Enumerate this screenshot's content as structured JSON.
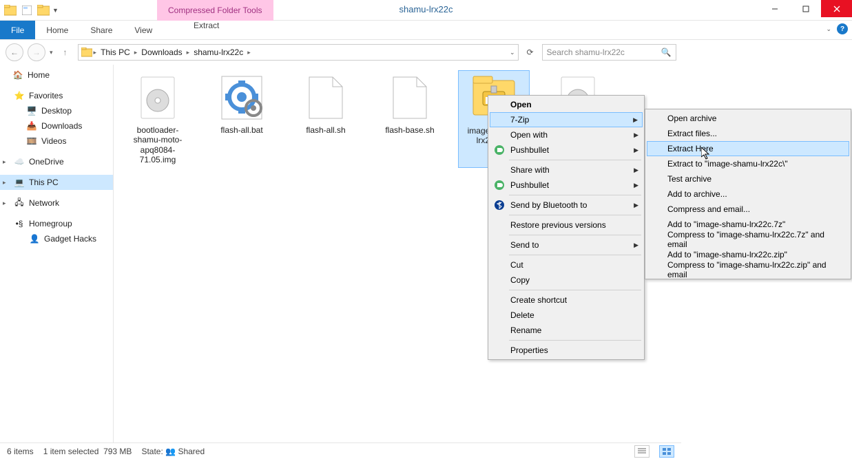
{
  "window": {
    "title": "shamu-lrx22c",
    "contextual_tab": "Compressed Folder Tools"
  },
  "ribbon": {
    "file": "File",
    "tabs": [
      "Home",
      "Share",
      "View"
    ],
    "extract": "Extract"
  },
  "breadcrumb": [
    "This PC",
    "Downloads",
    "shamu-lrx22c"
  ],
  "search": {
    "placeholder": "Search shamu-lrx22c"
  },
  "sidebar": {
    "home": "Home",
    "favorites": "Favorites",
    "fav_items": [
      "Desktop",
      "Downloads",
      "Videos"
    ],
    "onedrive": "OneDrive",
    "thispc": "This PC",
    "network": "Network",
    "homegroup": "Homegroup",
    "hg_items": [
      "Gadget Hacks"
    ]
  },
  "files": [
    {
      "name": "bootloader-shamu-moto-apq8084-71.05.img",
      "type": "disc"
    },
    {
      "name": "flash-all.bat",
      "type": "bat"
    },
    {
      "name": "flash-all.sh",
      "type": "blank"
    },
    {
      "name": "flash-base.sh",
      "type": "blank"
    },
    {
      "name": "image-shamu-lrx22c.zip",
      "type": "zip",
      "selected": true
    },
    {
      "name": "",
      "type": "disc"
    }
  ],
  "context_menu": {
    "open": "Open",
    "sevenzip": "7-Zip",
    "openwith": "Open with",
    "pushbullet": "Pushbullet",
    "sharewith": "Share with",
    "pushbullet2": "Pushbullet",
    "sendbt": "Send by Bluetooth to",
    "restore": "Restore previous versions",
    "sendto": "Send to",
    "cut": "Cut",
    "copy": "Copy",
    "shortcut": "Create shortcut",
    "delete": "Delete",
    "rename": "Rename",
    "properties": "Properties"
  },
  "submenu": {
    "open_archive": "Open archive",
    "extract_files": "Extract files...",
    "extract_here": "Extract Here",
    "extract_to": "Extract to \"image-shamu-lrx22c\\\"",
    "test": "Test archive",
    "add": "Add to archive...",
    "compress_email": "Compress and email...",
    "add_7z": "Add to \"image-shamu-lrx22c.7z\"",
    "compress_7z_email": "Compress to \"image-shamu-lrx22c.7z\" and email",
    "add_zip": "Add to \"image-shamu-lrx22c.zip\"",
    "compress_zip_email": "Compress to \"image-shamu-lrx22c.zip\" and email"
  },
  "status": {
    "count": "6 items",
    "selected": "1 item selected",
    "size": "793 MB",
    "state_label": "State:",
    "state": "Shared"
  }
}
